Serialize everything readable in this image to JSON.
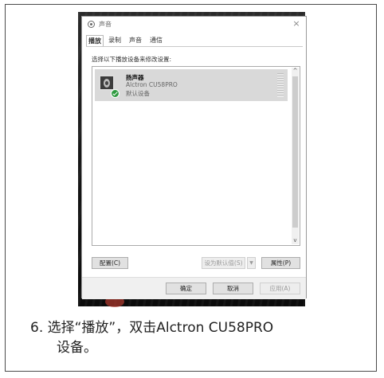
{
  "dialog": {
    "title": "声音",
    "close_glyph": "×",
    "tabs": [
      {
        "label": "播放",
        "active": true
      },
      {
        "label": "录制",
        "active": false
      },
      {
        "label": "声音",
        "active": false
      },
      {
        "label": "通信",
        "active": false
      }
    ],
    "instruction": "选择以下播放设备来修改设置:",
    "device": {
      "name": "扬声器",
      "model": "Alctron CU58PRO",
      "status": "默认设备",
      "icon": "speaker-icon",
      "status_icon": "check-badge-icon",
      "status_color": "#2f9a40"
    },
    "scroll": {
      "up": "^",
      "down": "v"
    },
    "buttons": {
      "configure": "配置(C)",
      "set_default": "设为默认值(S)",
      "set_default_arrow": "▼",
      "properties": "属性(P)",
      "ok": "确定",
      "cancel": "取消",
      "apply": "应用(A)"
    }
  },
  "caption": {
    "line1": "6. 选择“播放”，双击Alctron CU58PRO",
    "line2": "设备。"
  }
}
